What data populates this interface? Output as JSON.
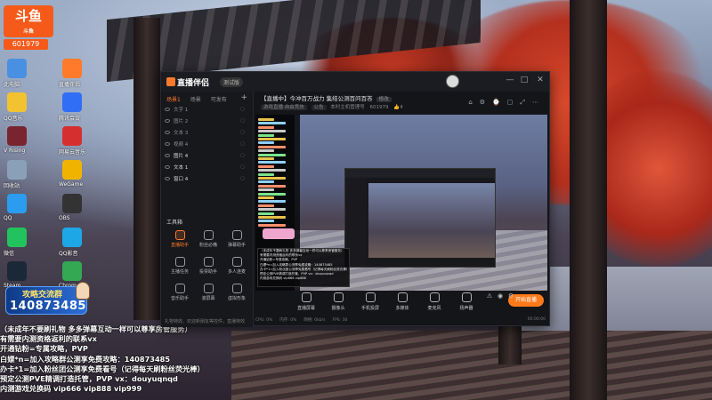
{
  "desktop": {
    "douyu_logo": "斗鱼",
    "douyu_room_label": "斗鱼",
    "room_number": "601979",
    "icons": [
      {
        "label": "此电脑",
        "color": "#4a90e2"
      },
      {
        "label": "QQ音乐",
        "color": "#f2c230"
      },
      {
        "label": "V Rising",
        "color": "#7a2430"
      },
      {
        "label": "回收站",
        "color": "#8aa0b8"
      },
      {
        "label": "QQ",
        "color": "#2b9cf0"
      },
      {
        "label": "微信",
        "color": "#22c35e"
      },
      {
        "label": "Steam",
        "color": "#1b2838"
      },
      {
        "label": "直播伴侣",
        "color": "#ff7a2a"
      },
      {
        "label": "腾讯会议",
        "color": "#2f6ef5"
      },
      {
        "label": "网易云音乐",
        "color": "#d62f2f"
      },
      {
        "label": "WeGame",
        "color": "#f0b400"
      },
      {
        "label": "OBS",
        "color": "#333"
      },
      {
        "label": "QQ影音",
        "color": "#1ea7e6"
      },
      {
        "label": "Chrome",
        "color": "#34a853"
      }
    ],
    "group_card": {
      "title": "攻略交流群",
      "number": "140873485"
    }
  },
  "overlay_lines": [
    "（未成年不要刷礼物 多多弹幕互动一样可以尊享房管服务）",
    "有需要内测资格返利的联系vx",
    "开通钻粉=专属攻略，PVP",
    "白嫖*n=加入攻略群公测享免费攻略：140873485",
    "办卡*1=加入粉丝团公测享免费看号（记得每天刷粉丝荧光棒）",
    "预定公测PVE精调打造托管，PVP  vx：douyuqnqd",
    "内测游戏兑换码 vip666 vip888  vip999"
  ],
  "app": {
    "logo": "直播伴侣",
    "version": "测试版",
    "window_controls": [
      "—",
      "□",
      "✕"
    ],
    "left_tabs": [
      "场景1",
      "场景",
      "可发布"
    ],
    "layers": [
      {
        "label": "文字 1",
        "bright": false
      },
      {
        "label": "图片 2",
        "bright": false
      },
      {
        "label": "文本 3",
        "bright": false
      },
      {
        "label": "视频 4",
        "bright": false
      },
      {
        "label": "图片 4",
        "bright": true
      },
      {
        "label": "文本 1",
        "bright": true
      },
      {
        "label": "窗口 4",
        "bright": true
      }
    ],
    "tools_title": "工具箱",
    "tools": [
      {
        "label": "直播助手",
        "hot": true
      },
      {
        "label": "粉丝必備",
        "hot": false
      },
      {
        "label": "弹幕助手",
        "hot": false
      },
      {
        "label": "主播任务",
        "hot": false
      },
      {
        "label": "投票助手",
        "hot": false
      },
      {
        "label": "多人连麦",
        "hot": false
      },
      {
        "label": "音乐助手",
        "hot": false
      },
      {
        "label": "滚屏幕",
        "hot": false
      },
      {
        "label": "虚拟形象",
        "hot": false
      }
    ],
    "left_footer": "礼物特效、欢迎新朋友等控件，直播特效",
    "room_title": "【直播中】今冲百万战力 集结公测百问百答",
    "room_title_tag": "修改",
    "room_sub": {
      "chips": [
        "游戏直播·自由竞技",
        "公告"
      ],
      "extra": "本时主机管理号",
      "room_no": "601979",
      "likes": "4"
    },
    "head_icons": [
      "⌂",
      "⚙",
      "⌚",
      "▢",
      "⤢",
      "⋯"
    ],
    "bottom_items": [
      "直播屏幕",
      "摄像头",
      "手机投屏",
      "多媒体",
      "麦克风",
      "扬声器"
    ],
    "bottom_right_icons": [
      "⚠",
      "◉",
      "⚙"
    ],
    "go_live": "开始直播",
    "status": [
      "CPU: 0%",
      "内存: 0%",
      "网络: 0kb/s",
      "FPS: 30",
      "00:00:00"
    ],
    "tooltip_lines": [
      "（未成年不要刷礼物 多多弹幕互动一样可以尊享房管服务）",
      "有需要内测资格返利的联系vx",
      "开通钻粉=专属攻略，PVP",
      "白嫖*n=加入攻略群公测享免费攻略：140873485",
      "办卡*1=加入粉丝团公测享免费看号（记得每天刷粉丝荧光棒）",
      "预定公测PVE精调打造托管，PVP  vx：douyuqnqd",
      "内测游戏兑换码 vip666 vip888"
    ]
  },
  "colors": {
    "accent": "#ff7a2a",
    "douyu_orange": "#f55a1a",
    "card_blue": "#2c6ed6"
  }
}
